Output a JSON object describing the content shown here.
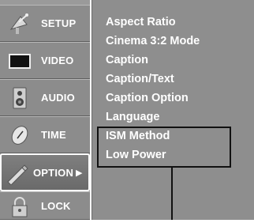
{
  "menu": {
    "items": [
      {
        "label": "SETUP",
        "icon": "satellite-dish-icon"
      },
      {
        "label": "VIDEO",
        "icon": "tv-screen-icon"
      },
      {
        "label": "AUDIO",
        "icon": "speaker-icon"
      },
      {
        "label": "TIME",
        "icon": "clock-icon"
      },
      {
        "label": "OPTION",
        "icon": "pen-icon",
        "selected": true,
        "arrow": "▶"
      },
      {
        "label": "LOCK",
        "icon": "padlock-icon"
      }
    ]
  },
  "submenu": {
    "items": [
      "Aspect Ratio",
      "Cinema 3:2 Mode",
      "Caption",
      "Caption/Text",
      "Caption Option",
      "Language",
      "ISM Method",
      "Low Power"
    ],
    "highlighted": [
      "ISM Method",
      "Low Power"
    ]
  },
  "colors": {
    "menu_bg": "#8c8c8c",
    "panel_bg": "#8e8e8e",
    "text": "#ffffff",
    "callout": "#111111"
  }
}
